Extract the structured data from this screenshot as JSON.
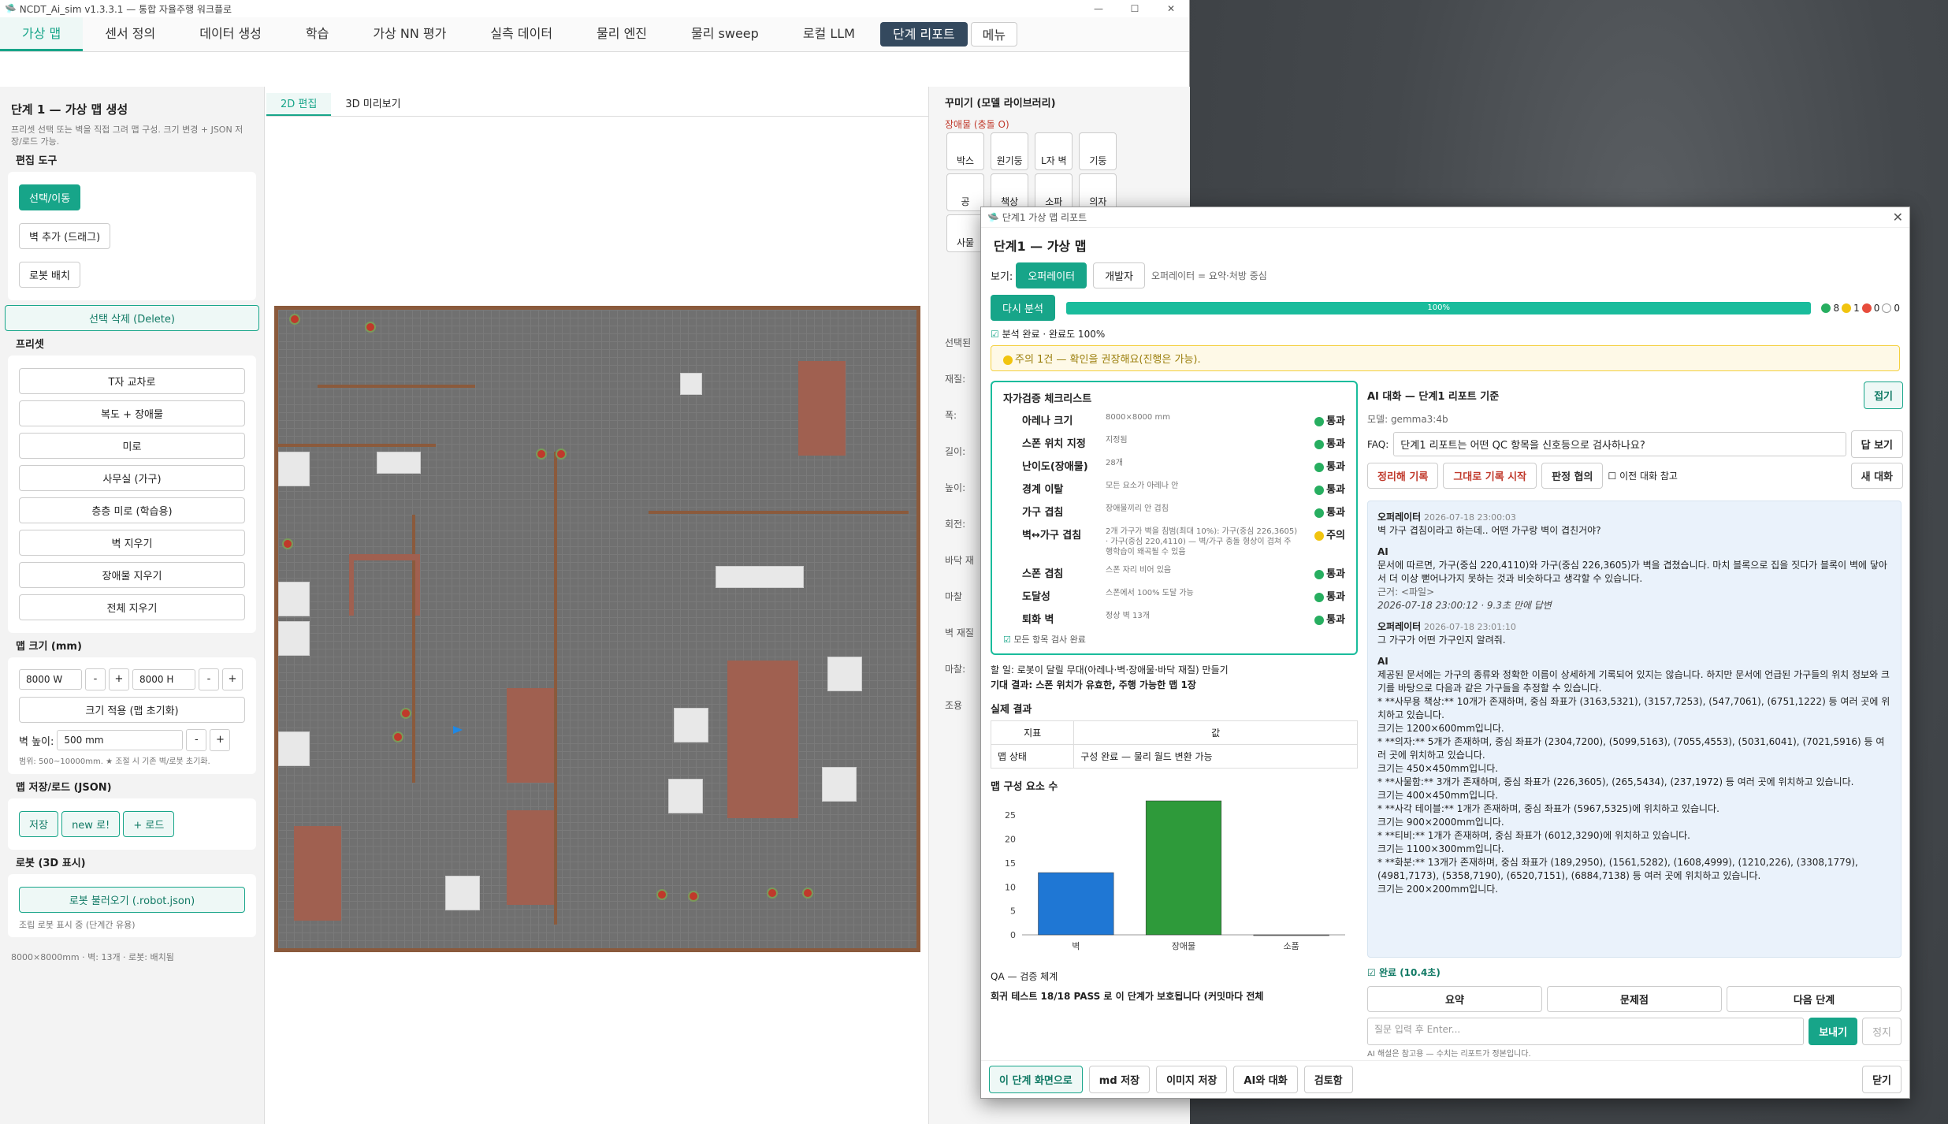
{
  "window": {
    "title": "NCDT_Ai_sim v1.3.3.1 — 통합 자율주행 워크플로"
  },
  "tabs": [
    "가상 맵",
    "센서 정의",
    "데이터 생성",
    "학습",
    "가상 NN 평가",
    "실측 데이터",
    "물리 엔진",
    "물리 sweep",
    "로컬 LLM",
    "단계 리포트",
    "메뉴"
  ],
  "left": {
    "heading": "단계 1 — 가상 맵 생성",
    "desc": "프리셋 선택 또는 벽을 직접 그려 맵 구성. 크기 변경 + JSON 저장/로드 가능.",
    "edit_title": "편집 도구",
    "select_btn": "선택/이동",
    "wall_btn": "벽 추가 (드래그)",
    "robot_btn": "로봇 배치",
    "delete_btn": "선택 삭제 (Delete)",
    "preset_title": "프리셋",
    "presets": [
      "T자 교차로",
      "복도 + 장애물",
      "미로",
      "사무실 (가구)",
      "층층 미로 (학습용)",
      "벽 지우기",
      "장애물 지우기",
      "전체 지우기"
    ],
    "size_title": "맵 크기 (mm)",
    "width": "8000 W",
    "height": "8000 H",
    "apply_btn": "크기 적용 (맵 초기화)",
    "wall_h_label": "벽 높이:",
    "wall_h": "500 mm",
    "range": "범위: 500~10000mm. ★ 조절 시 기존 벽/로봇 초기화.",
    "save_title": "맵 저장/로드 (JSON)",
    "save_btn": "저장",
    "new_btn": "new 로!",
    "load_btn": "+ 로드",
    "robot_title": "로봇 (3D 표시)",
    "robot_load": "로봇 불러오기 (.robot.json)",
    "robot_chk": "조립 로봇 표시 중 (단계간 유용)",
    "status": "8000×8000mm · 벽: 13개 · 로봇: 배치됨"
  },
  "center": {
    "tab2d": "2D 편집",
    "tab3d": "3D 미리보기"
  },
  "right": {
    "title": "꾸미기 (모델 라이브러리)",
    "obs_title": "장애물 (충돌 O)",
    "items": [
      "박스",
      "원기둥",
      "L자 벽",
      "기둥",
      "공",
      "책상",
      "소파",
      "의자",
      "사물"
    ],
    "labels": [
      "조",
      "선택된",
      "재질:",
      "폭:",
      "길이:",
      "높이:",
      "회전:",
      "바닥 재",
      "마찰",
      "벽 재질",
      "마찰:",
      "조용"
    ]
  },
  "dialog": {
    "wintitle": "단계1 가상 맵 리포트",
    "heading": "단계1 — 가상 맵",
    "view_label": "보기:",
    "view_op": "오퍼레이터",
    "view_dev": "개발자",
    "view_note": "오퍼레이터 = 요약·처방 중심",
    "reanalyze": "다시 분석",
    "progress": 100,
    "progress_text": "100%",
    "counts": {
      "green": "8",
      "yellow": "1",
      "red": "0",
      "empty": "0"
    },
    "status_line": "분석 완료 · 완료도 100%",
    "warning": "주의 1건 — 확인을 권장해요(진행은 가능).",
    "checklist_title": "자가검증 체크리스트",
    "checks": [
      {
        "name": "아레나 크기",
        "desc": "8000×8000 mm",
        "status": "통과",
        "color": "#27ae60"
      },
      {
        "name": "스폰 위치 지정",
        "desc": "지정됨",
        "status": "통과",
        "color": "#27ae60"
      },
      {
        "name": "난이도(장애물)",
        "desc": "28개",
        "status": "통과",
        "color": "#27ae60"
      },
      {
        "name": "경계 이탈",
        "desc": "모든 요소가 아레나 안",
        "status": "통과",
        "color": "#27ae60"
      },
      {
        "name": "가구 겹침",
        "desc": "장애물끼리 안 겹침",
        "status": "통과",
        "color": "#27ae60"
      },
      {
        "name": "벽↔가구 겹침",
        "desc": "2개 가구가 벽을 침범(최대 10%): 가구(중심 226,3605) · 가구(중심 220,4110) — 벽/가구 충돌 형상이 겹쳐 주행학습이 왜곡될 수 있음",
        "status": "주의",
        "color": "#f1c40f"
      },
      {
        "name": "스폰 겹침",
        "desc": "스폰 자리 비어 있음",
        "status": "통과",
        "color": "#27ae60"
      },
      {
        "name": "도달성",
        "desc": "스폰에서 100% 도달 가능",
        "status": "통과",
        "color": "#27ae60"
      },
      {
        "name": "퇴화 벽",
        "desc": "정상 벽 13개",
        "status": "통과",
        "color": "#27ae60"
      }
    ],
    "check_done": "모든 항목 검사 완료",
    "todo": "할 일: 로봇이 달릴 무대(아레나·벽·장애물·바닥 재질) 만들기",
    "expect": "기대 결과: 스폰 위치가 유효한, 주행 가능한 맵 1장",
    "result_title": "실제 결과",
    "tbl_h": [
      "지표",
      "값"
    ],
    "tbl_r": [
      "맵 상태",
      "구성 완료 — 물리 월드 변환 가능"
    ],
    "chart_title": "맵 구성 요소 수",
    "qa_title": "QA — 검증 체계",
    "qa_text": "회귀 테스트 18/18 PASS 로 이 단계가 보호됩니다 (커밋마다 전체",
    "ai_title": "AI 대화 — 단계1 리포트 기준",
    "collapse": "접기",
    "model": "모델: gemma3:4b",
    "faq_label": "FAQ:",
    "faq": "단계1 리포트는 어떤 QC 항목을 신호등으로 검사하나요?",
    "answer_btn": "답 보기",
    "chat_btns": [
      "정리해 기록",
      "그대로 기록 시작",
      "판정 협의"
    ],
    "prev_ref": "이전 대화 참고",
    "new_chat": "새 대화",
    "msgs": [
      {
        "who": "오퍼레이터",
        "time": "2026-07-18 23:00:03",
        "text": "벽 가구 겹침이라고 하는데.. 어떤 가구랑 벽이 겹친거야?"
      },
      {
        "who": "AI",
        "text": "문서에 따르면, 가구(중심 220,4110)와 가구(중심 226,3605)가 벽을 겹쳤습니다. 마치 블록으로 집을 짓다가 블록이 벽에 닿아서 더 이상 뻗어나가지 못하는 것과 비슷하다고 생각할 수 있습니다.",
        "src": "근거: <파일>",
        "meta": "2026-07-18 23:00:12 · 9.3초 만에 답변"
      },
      {
        "who": "오퍼레이터",
        "time": "2026-07-18 23:01:10",
        "text": "그 가구가 어떤 가구인지 알려줘."
      },
      {
        "who": "AI",
        "text": "제공된 문서에는 가구의 종류와 정확한 이름이 상세하게 기록되어 있지는 않습니다. 하지만 문서에 언급된 가구들의 위치 정보와 크기를 바탕으로 다음과 같은 가구들을 추정할 수 있습니다.\n* **사무용 책상:** 10개가 존재하며, 중심 좌표가 (3163,5321), (3157,7253), (547,7061), (6751,1222) 등 여러 곳에 위치하고 있습니다.\n크기는 1200×600mm입니다.\n* **의자:** 5개가 존재하며, 중심 좌표가 (2304,7200), (5099,5163), (7055,4553), (5031,6041), (7021,5916) 등 여러 곳에 위치하고 있습니다.\n크기는 450×450mm입니다.\n* **사물함:** 3개가 존재하며, 중심 좌표가 (226,3605), (265,5434), (237,1972) 등 여러 곳에 위치하고 있습니다.\n크기는 400×450mm입니다.\n* **사각 테이블:** 1개가 존재하며, 중심 좌표가 (5967,5325)에 위치하고 있습니다.\n크기는 900×2000mm입니다.\n* **티비:** 1개가 존재하며, 중심 좌표가 (6012,3290)에 위치하고 있습니다.\n크기는 1100×300mm입니다.\n* **화분:** 13개가 존재하며, 중심 좌표가 (189,2950), (1561,5282), (1608,4999), (1210,226), (3308,1779), (4981,7173), (5358,7190), (6520,7151), (6884,7138) 등 여러 곳에 위치하고 있습니다.\n크기는 200×200mm입니다."
      }
    ],
    "done": "완료 (10.4초)",
    "act": [
      "요약",
      "문제점",
      "다음 단계"
    ],
    "input_ph": "질문 입력 후 Enter...",
    "send": "보내기",
    "stop": "정지",
    "ai_note": "AI 해설은 참고용 — 수치는 리포트가 정본입니다.",
    "foot": [
      "이 단계 화면으로",
      "md 저장",
      "이미지 저장",
      "AI와 대화",
      "검토함"
    ],
    "close": "닫기"
  },
  "chart_data": {
    "type": "bar",
    "categories": [
      "벽",
      "장애물",
      "소품"
    ],
    "values": [
      13,
      28,
      0
    ],
    "colors": [
      "#1f77d4",
      "#2e9a3a",
      "#888888"
    ],
    "title": "맵 구성 요소 수",
    "ylim": [
      0,
      28
    ],
    "yticks": [
      0,
      5,
      10,
      15,
      20,
      25
    ]
  }
}
